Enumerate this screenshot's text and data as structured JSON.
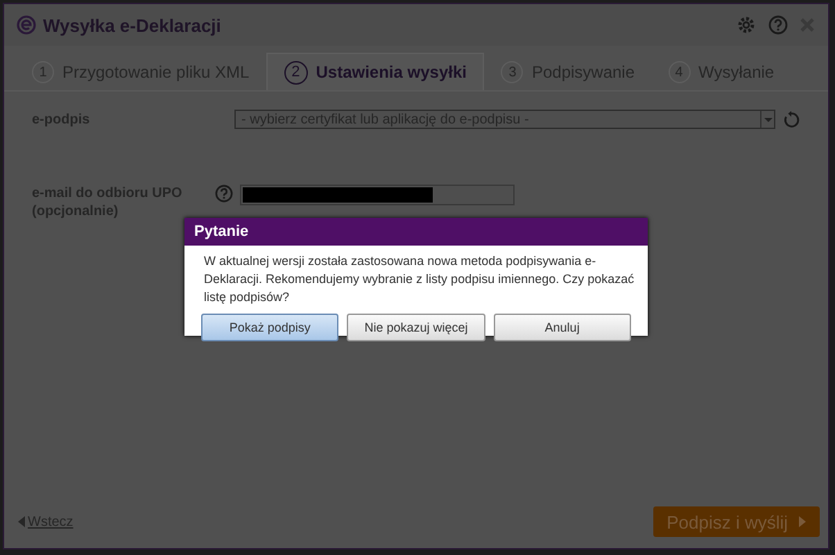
{
  "window": {
    "title": "Wysyłka e-Deklaracji"
  },
  "tabs": [
    {
      "number": "1",
      "label": "Przygotowanie pliku XML",
      "selected": false
    },
    {
      "number": "2",
      "label": "Ustawienia wysyłki",
      "selected": true
    },
    {
      "number": "3",
      "label": "Podpisywanie",
      "selected": false
    },
    {
      "number": "4",
      "label": "Wysyłanie",
      "selected": false
    }
  ],
  "form": {
    "signature_label": "e-podpis",
    "signature_select": "- wybierz certyfikat lub aplikację do e-podpisu -",
    "email_label": "e-mail do odbioru UPO (opcjonalnie)"
  },
  "dialog": {
    "title": "Pytanie",
    "message": "W aktualnej wersji została zastosowana nowa metoda podpisywania e-Deklaracji. Rekomendujemy wybranie z listy podpisu imiennego. Czy pokazać listę podpisów?",
    "buttons": [
      {
        "label": "Pokaż podpisy",
        "selected": true
      },
      {
        "label": "Nie pokazuj więcej",
        "selected": false
      },
      {
        "label": "Anuluj",
        "selected": false
      }
    ]
  },
  "footer": {
    "back": "Wstecz",
    "submit": "Podpisz i wyślij"
  }
}
